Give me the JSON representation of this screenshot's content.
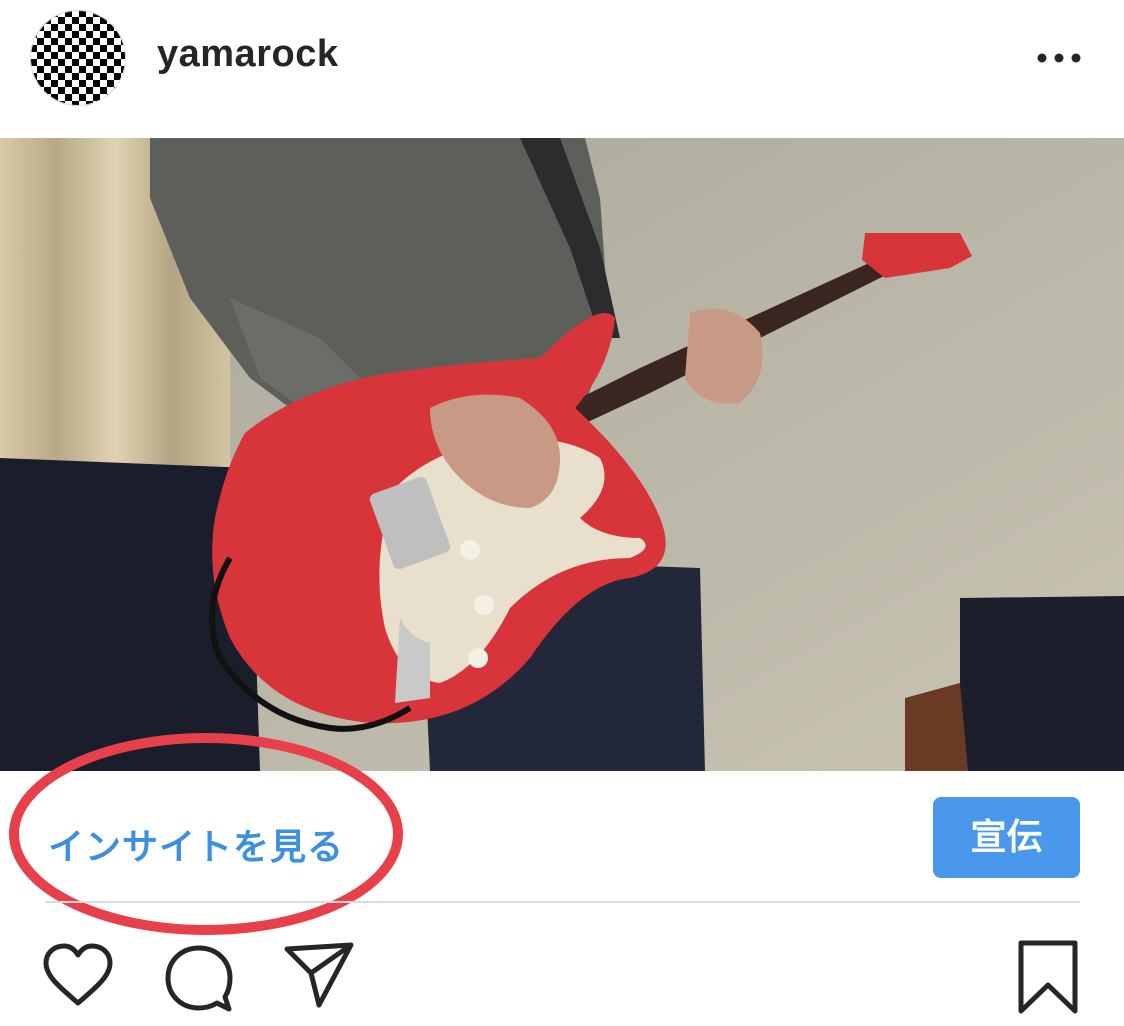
{
  "post": {
    "username": "yamarock",
    "insight_label": "インサイトを見る",
    "promote_label": "宣伝"
  },
  "colors": {
    "link_blue": "#3d8fe0",
    "promote_button": "#4a98ec",
    "highlight_circle": "#e8404a",
    "guitar_red": "#d8353a"
  },
  "icons": {
    "more": "more-horizontal-icon",
    "like": "heart-icon",
    "comment": "comment-icon",
    "share": "send-icon",
    "save": "bookmark-icon"
  }
}
